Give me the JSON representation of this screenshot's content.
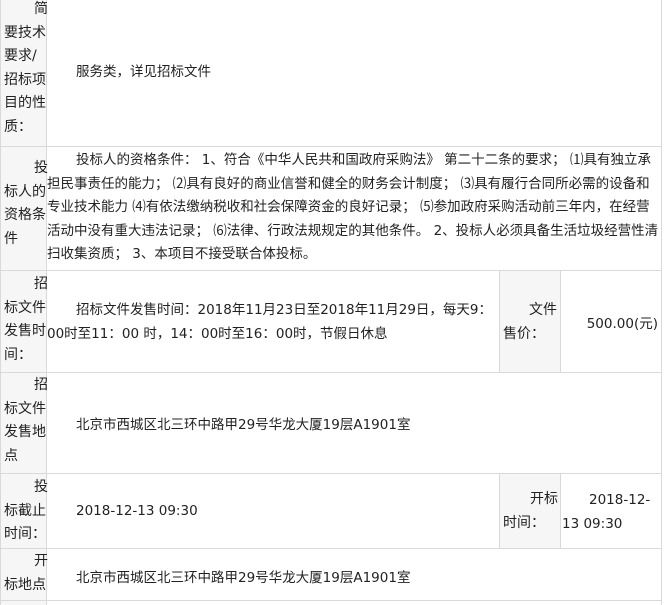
{
  "rows": {
    "nature": {
      "label": "简要技术要求/招标项目的性质：",
      "value": "服务类，详见招标文件"
    },
    "qualification": {
      "label": "投标人的资格条件",
      "value": "投标人的资格条件： 1、符合《中华人民共和国政府采购法》 第二十二条的要求； ⑴具有独立承担民事责任的能力； ⑵具有良好的商业信誉和健全的财务会计制度； ⑶具有履行合同所必需的设备和专业技术能力 ⑷有依法缴纳税收和社会保障资金的良好记录； ⑸参加政府采购活动前三年内，在经营活动中没有重大违法记录； ⑹法律、行政法规规定的其他条件。 2、投标人必须具备生活垃圾经营性清扫收集资质； 3、本项目不接受联合体投标。"
    },
    "sale_time": {
      "label": "招标文件发售时间：",
      "value": "招标文件发售时间：2018年11月23日至2018年11月29日，每天9：00时至11：00 时，14：00时至16：00时，节假日休息",
      "price_label": "文件售价：",
      "price_value": "500.00(元)"
    },
    "sale_place": {
      "label": "招标文件发售地点",
      "value": "北京市西城区北三环中路甲29号华龙大厦19层A1901室"
    },
    "deadline": {
      "label": "投标截止时间：",
      "value": "2018-12-13 09:30",
      "open_label": "开标时间：",
      "open_value": "2018-12-13 09:30"
    },
    "open_place": {
      "label": "开标地点",
      "value": "北京市西城区北三环中路甲29号华龙大厦19层A1901室"
    }
  }
}
